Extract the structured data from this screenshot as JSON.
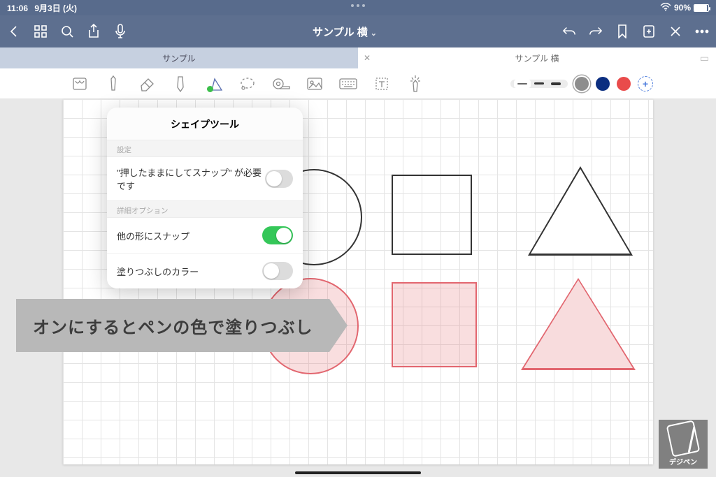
{
  "status": {
    "time": "11:06",
    "date": "9月3日 (火)",
    "battery_pct": "90%"
  },
  "nav": {
    "title": "サンプル 横"
  },
  "tabs": {
    "inactive": "サンプル",
    "active": "サンプル 横"
  },
  "popover": {
    "title": "シェイプツール",
    "section_settings": "設定",
    "row_hold_snap": "\"押したままにしてスナップ\" が必要です",
    "section_advanced": "詳細オプション",
    "row_snap_other": "他の形にスナップ",
    "row_fill_color": "塗りつぶしのカラー"
  },
  "callout": "オンにするとペンの色で塗りつぶし",
  "watermark": "デジペン",
  "colors": {
    "grey": "#8d8d8d",
    "navy": "#0b2e80",
    "red": "#e94b4b"
  }
}
